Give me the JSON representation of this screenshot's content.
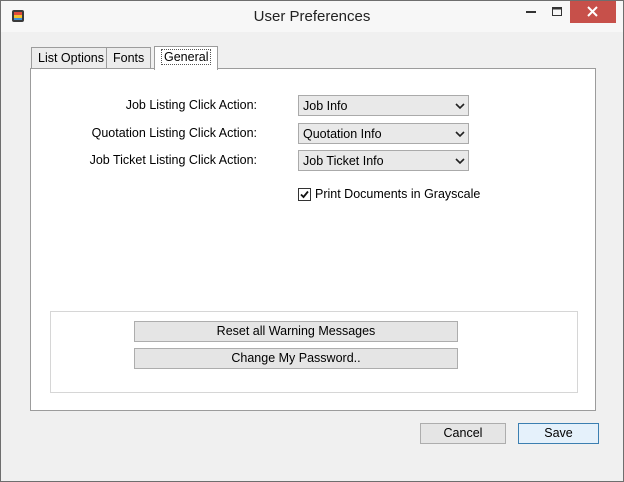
{
  "window": {
    "title": "User Preferences",
    "close_color": "#c7504a"
  },
  "tabs": [
    {
      "label": "List Options"
    },
    {
      "label": "Fonts"
    },
    {
      "label": "General",
      "selected": true
    }
  ],
  "general": {
    "job_listing_label": "Job Listing Click Action:",
    "job_listing_value": "Job Info",
    "quotation_listing_label": "Quotation Listing Click Action:",
    "quotation_listing_value": "Quotation Info",
    "job_ticket_listing_label": "Job Ticket Listing Click Action:",
    "job_ticket_listing_value": "Job Ticket Info",
    "grayscale_label": "Print Documents in Grayscale",
    "grayscale_checked": true,
    "reset_warnings_label": "Reset all Warning Messages",
    "change_password_label": "Change My Password.."
  },
  "footer": {
    "cancel_label": "Cancel",
    "save_label": "Save"
  },
  "icons": {
    "app": "app-icon",
    "minimize": "minimize-icon",
    "maximize": "maximize-icon",
    "close": "close-icon",
    "dropdown": "chevron-down-icon",
    "check": "checkmark-icon"
  }
}
